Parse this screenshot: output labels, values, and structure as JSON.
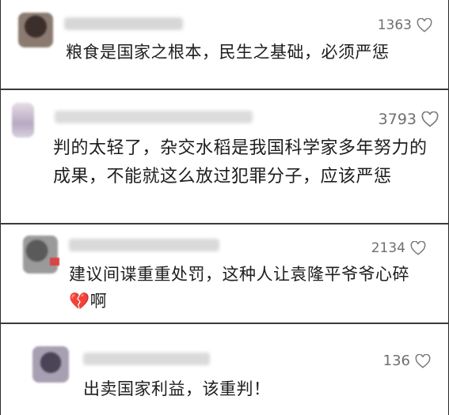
{
  "comments": [
    {
      "likes": "1363",
      "text": "粮食是国家之根本，民生之基础，必须严惩",
      "avatar_color": "#6b5a52"
    },
    {
      "likes": "3793",
      "text": "判的太轻了，杂交水稻是我国科学家多年努力的成果，不能就这么放过犯罪分子，应该严惩",
      "avatar_color": "#c7b9c6"
    },
    {
      "likes": "2134",
      "text_before_emoji": "建议间谍重重处罚，这种人让袁隆平爷爷心碎",
      "emoji": "💔",
      "text_after_emoji": "啊",
      "avatar_color": "#7a7a7a"
    },
    {
      "likes": "136",
      "text": "出卖国家利益，该重判！",
      "avatar_color": "#8c8094"
    }
  ],
  "colors": {
    "like_text": "#6f6f6f",
    "body_text": "#1d1d1d",
    "separator": "#3a3a3a"
  },
  "icons": {
    "like": "heart-outline-icon",
    "broken_heart": "broken-heart-emoji"
  }
}
